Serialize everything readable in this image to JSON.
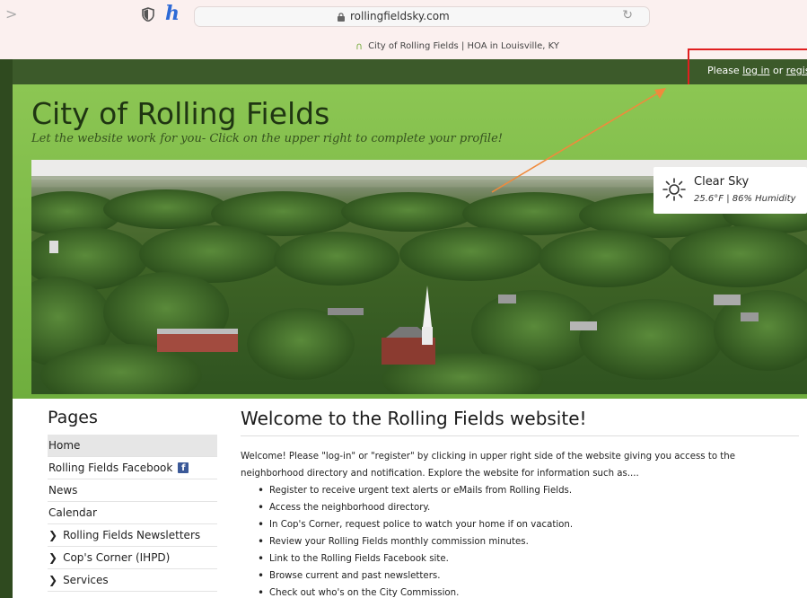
{
  "browser": {
    "url": "rollingfieldsky.com",
    "tab_title": "City of Rolling Fields | HOA in Louisville, KY"
  },
  "topbar": {
    "prefix": "Please ",
    "login_link": "log in",
    "middle": " or ",
    "register_link": "registe"
  },
  "header": {
    "title": "City of Rolling Fields",
    "tagline": "Let the website work for you- Click on the upper right to complete your profile!"
  },
  "weather": {
    "condition": "Clear Sky",
    "details": "25.6°F | 86% Humidity",
    "icon": "sun-icon"
  },
  "sidebar": {
    "heading": "Pages",
    "items": [
      {
        "label": "Home",
        "expandable": false,
        "active": true
      },
      {
        "label": "Rolling Fields Facebook",
        "expandable": false,
        "facebook": true
      },
      {
        "label": "News",
        "expandable": false
      },
      {
        "label": "Calendar",
        "expandable": false
      },
      {
        "label": "Rolling Fields Newsletters",
        "expandable": true
      },
      {
        "label": "Cop's Corner (IHPD)",
        "expandable": true
      },
      {
        "label": "Services",
        "expandable": true
      }
    ]
  },
  "main": {
    "heading": "Welcome to the Rolling Fields website!",
    "intro": "Welcome! Please \"log-in\" or \"register\" by clicking in upper right side of the website giving you access to the neighborhood directory and notification.  Explore the website for information such as....",
    "bullets": [
      "Register to receive urgent text alerts or eMails from Rolling Fields.",
      "Access the neighborhood directory.",
      "In Cop's Corner, request police to watch your home if on vacation.",
      "Review your Rolling Fields monthly commission minutes.",
      "Link to the Rolling Fields Facebook site.",
      "Browse current and past newsletters.",
      "Check out who's on the City Commission."
    ]
  },
  "colors": {
    "header_green": "#8cc653",
    "topbar_green": "#3c5a2a",
    "annotation_red": "#e01f1f",
    "annotation_orange": "#f08a3c"
  }
}
